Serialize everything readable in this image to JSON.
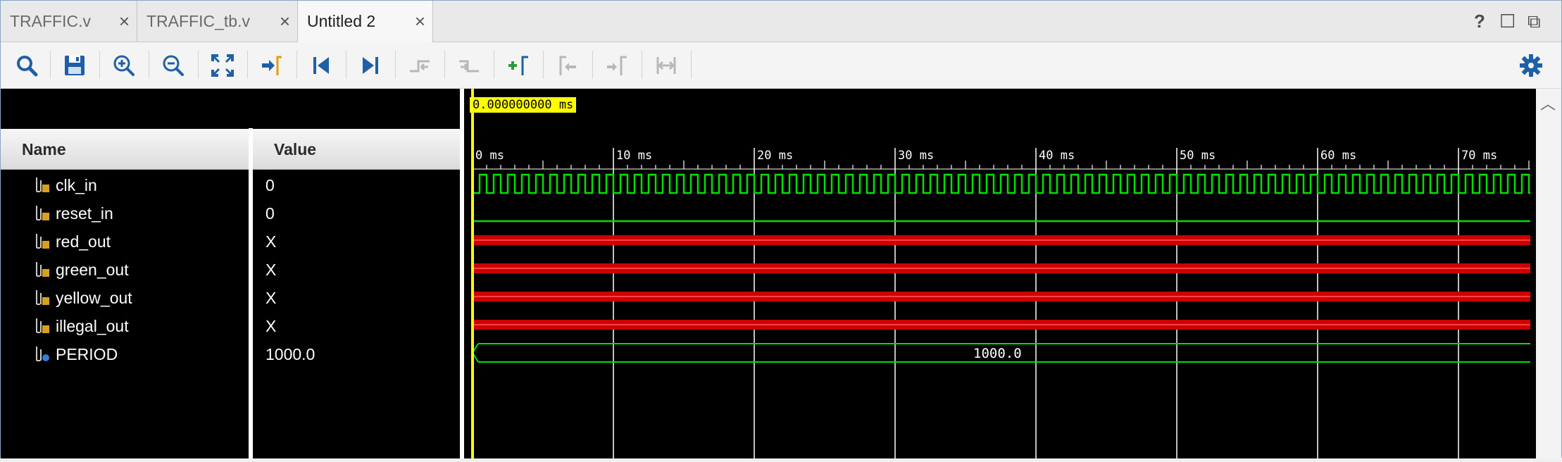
{
  "tabs": [
    {
      "label": "TRAFFIC.v",
      "active": false
    },
    {
      "label": "TRAFFIC_tb.v",
      "active": false
    },
    {
      "label": "Untitled 2",
      "active": true
    }
  ],
  "tab_close_glyph": "×",
  "window_controls": {
    "help": "?",
    "maximize": "☐",
    "restore": "⧉"
  },
  "toolbar": [
    {
      "icon": "search-icon",
      "tooltip": "Search"
    },
    {
      "icon": "save-icon",
      "tooltip": "Save"
    },
    {
      "icon": "zoom-in-icon",
      "tooltip": "Zoom In"
    },
    {
      "icon": "zoom-out-icon",
      "tooltip": "Zoom Out"
    },
    {
      "icon": "zoom-fit-icon",
      "tooltip": "Zoom Fit"
    },
    {
      "icon": "go-to-cursor-icon",
      "tooltip": "Go to Cursor"
    },
    {
      "icon": "go-to-time-0-icon",
      "tooltip": "Go to Time 0"
    },
    {
      "icon": "go-to-last-time-icon",
      "tooltip": "Go to Last Time"
    },
    {
      "icon": "previous-transition-icon",
      "tooltip": "Previous Transition"
    },
    {
      "icon": "next-transition-icon",
      "tooltip": "Next Transition"
    },
    {
      "icon": "add-marker-icon",
      "tooltip": "Add Marker"
    },
    {
      "icon": "previous-marker-icon",
      "tooltip": "Previous Marker"
    },
    {
      "icon": "next-marker-icon",
      "tooltip": "Next Marker"
    },
    {
      "icon": "swap-cursors-icon",
      "tooltip": "Swap Cursors"
    }
  ],
  "settings_icon": "gear-icon",
  "columns": {
    "name": "Name",
    "value": "Value"
  },
  "cursor_time": "0.000000000 ms",
  "signals": [
    {
      "name": "clk_in",
      "value": "0",
      "kind": "clock"
    },
    {
      "name": "reset_in",
      "value": "0",
      "kind": "low"
    },
    {
      "name": "red_out",
      "value": "X",
      "kind": "unknown"
    },
    {
      "name": "green_out",
      "value": "X",
      "kind": "unknown"
    },
    {
      "name": "yellow_out",
      "value": "X",
      "kind": "unknown"
    },
    {
      "name": "illegal_out",
      "value": "X",
      "kind": "unknown"
    },
    {
      "name": "PERIOD",
      "value": "1000.0",
      "kind": "bus",
      "bus_label": "1000.0"
    }
  ],
  "timeline": {
    "ticks": [
      "0 ms",
      "10 ms",
      "20 ms",
      "30 ms",
      "40 ms",
      "50 ms",
      "60 ms",
      "70 ms"
    ],
    "clock_period_ms": 1
  },
  "colors": {
    "wave_green": "#00e000",
    "unknown_red": "#cc0000",
    "cursor_yellow": "#ffff00",
    "grid": "#ffffff"
  }
}
